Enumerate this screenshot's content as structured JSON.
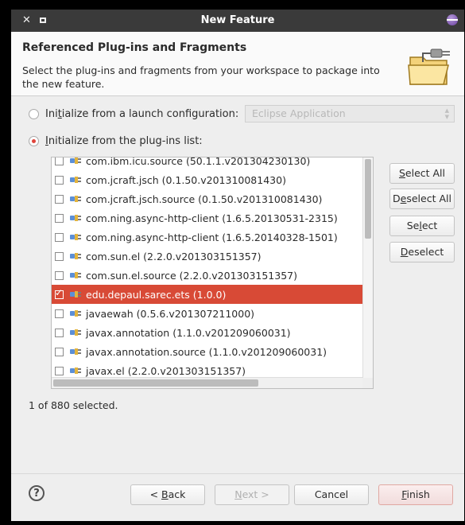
{
  "window": {
    "title": "New Feature"
  },
  "header": {
    "title": "Referenced Plug-ins and Fragments",
    "description": "Select the plug-ins and fragments from your workspace to package into the new feature."
  },
  "options": {
    "launch_config": {
      "label_pre": "Ini",
      "label_u": "t",
      "label_post": "ialize from a launch configuration:",
      "checked": false
    },
    "launch_config_value": "Eclipse Application",
    "plugins_list": {
      "label_pre": "",
      "label_u": "I",
      "label_post": "nitialize from the plug-ins list:",
      "checked": true
    }
  },
  "plugins": [
    {
      "name": "com.ibm.icu.source (50.1.1.v201304230130)",
      "checked": false,
      "selected": false
    },
    {
      "name": "com.jcraft.jsch (0.1.50.v201310081430)",
      "checked": false,
      "selected": false
    },
    {
      "name": "com.jcraft.jsch.source (0.1.50.v201310081430)",
      "checked": false,
      "selected": false
    },
    {
      "name": "com.ning.async-http-client (1.6.5.20130531-2315)",
      "checked": false,
      "selected": false
    },
    {
      "name": "com.ning.async-http-client (1.6.5.20140328-1501)",
      "checked": false,
      "selected": false
    },
    {
      "name": "com.sun.el (2.2.0.v201303151357)",
      "checked": false,
      "selected": false
    },
    {
      "name": "com.sun.el.source (2.2.0.v201303151357)",
      "checked": false,
      "selected": false
    },
    {
      "name": "edu.depaul.sarec.ets (1.0.0)",
      "checked": true,
      "selected": true
    },
    {
      "name": "javaewah (0.5.6.v201307211000)",
      "checked": false,
      "selected": false
    },
    {
      "name": "javax.annotation (1.1.0.v201209060031)",
      "checked": false,
      "selected": false
    },
    {
      "name": "javax.annotation.source (1.1.0.v201209060031)",
      "checked": false,
      "selected": false
    },
    {
      "name": "javax.el (2.2.0.v201303151357)",
      "checked": false,
      "selected": false
    }
  ],
  "side_buttons": {
    "select_all": {
      "pre": "",
      "u": "S",
      "post": "elect All"
    },
    "deselect_all": {
      "pre": "D",
      "u": "e",
      "post": "select All"
    },
    "select": {
      "pre": "Se",
      "u": "l",
      "post": "ect"
    },
    "deselect": {
      "pre": "",
      "u": "D",
      "post": "eselect"
    }
  },
  "status": "1 of 880 selected.",
  "footer": {
    "help": "?",
    "back": {
      "pre": "< ",
      "u": "B",
      "post": "ack",
      "enabled": true
    },
    "next": {
      "pre": "",
      "u": "N",
      "post": "ext >",
      "enabled": false
    },
    "cancel": {
      "label": "Cancel",
      "enabled": true
    },
    "finish": {
      "pre": "",
      "u": "F",
      "post": "inish",
      "enabled": true
    }
  },
  "colors": {
    "selection": "#d84a36",
    "titlebar": "#3a3a3a",
    "radio_accent": "#e0453c"
  },
  "icons": {
    "plugin": "plugin-icon",
    "feature_header": "folder-plug-icon",
    "help": "help-icon"
  }
}
